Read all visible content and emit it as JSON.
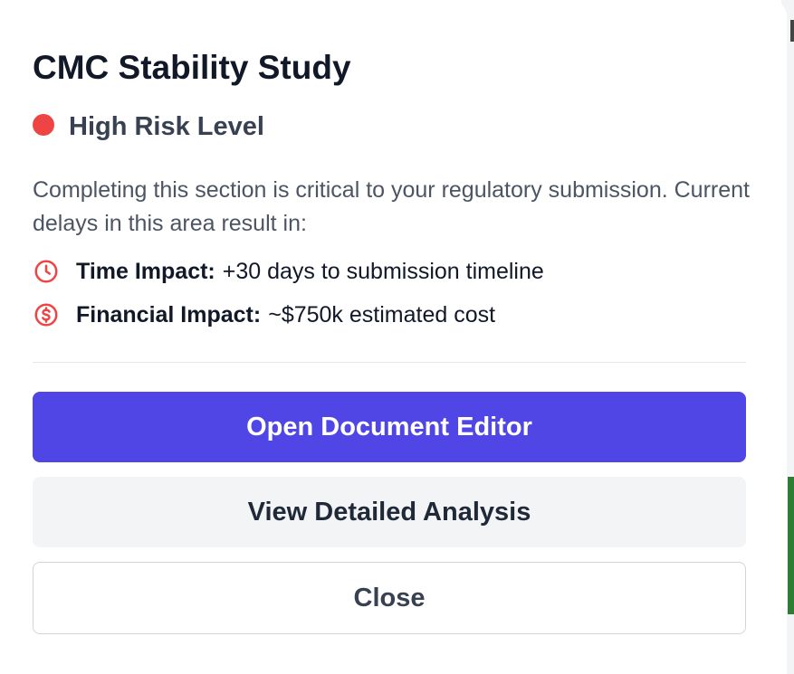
{
  "modal": {
    "title": "CMC Stability Study",
    "risk": {
      "label": "High Risk Level",
      "color": "#ef4444"
    },
    "description": "Completing this section is critical to your regulatory submission. Current delays in this area result in:",
    "impacts": [
      {
        "icon": "clock-icon",
        "label": "Time Impact:",
        "value": "+30 days to submission timeline"
      },
      {
        "icon": "dollar-circle-icon",
        "label": "Financial Impact:",
        "value": "~$750k estimated cost"
      }
    ],
    "buttons": {
      "primary": "Open Document Editor",
      "secondary": "View Detailed Analysis",
      "close": "Close"
    },
    "colors": {
      "primary": "#4f46e5",
      "risk": "#ef4444"
    }
  }
}
